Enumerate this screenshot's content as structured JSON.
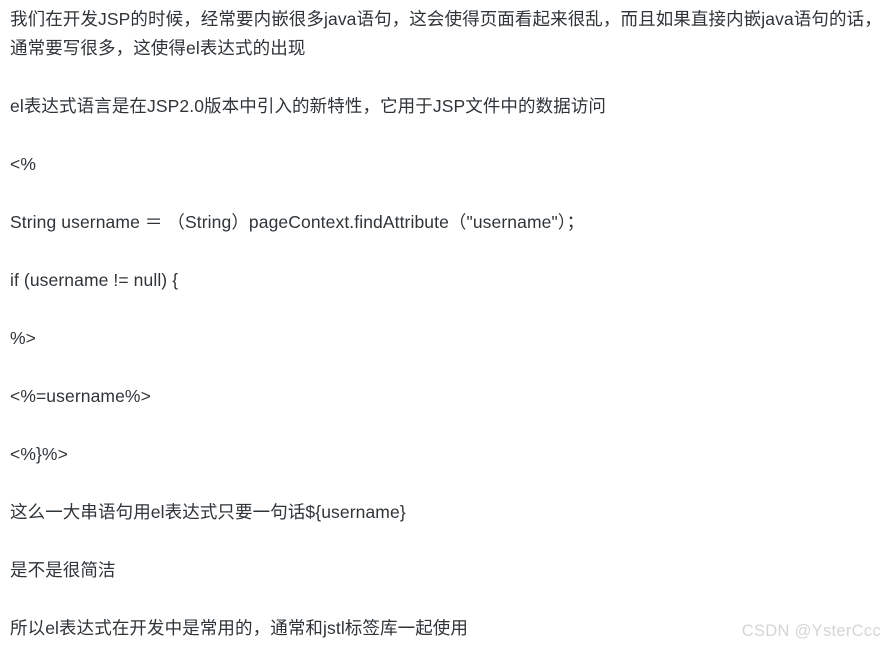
{
  "document": {
    "background_color": "#ffffff",
    "text_color": "#2f3438",
    "paragraphs": [
      {
        "id": "intro",
        "text": "我们在开发JSP的时候，经常要内嵌很多java语句，这会使得页面看起来很乱，而且如果直接内嵌java语句的话，通常要写很多，这使得el表达式的出现"
      },
      {
        "id": "definition",
        "text": "el表达式语言是在JSP2.0版本中引入的新特性，它用于JSP文件中的数据访问"
      },
      {
        "id": "code-open-scriptlet",
        "text": "<%"
      },
      {
        "id": "code-find-attribute",
        "text": "String username ＝ （String）pageContext.findAttribute（\"username\"）；"
      },
      {
        "id": "code-if-statement",
        "text": "if (username != null) {"
      },
      {
        "id": "code-close-scriptlet",
        "text": "%>"
      },
      {
        "id": "code-expression-output",
        "text": "<%=username%>"
      },
      {
        "id": "code-close-brace-scriptlet",
        "text": "<%}%>"
      },
      {
        "id": "el-one-liner",
        "text": "这么一大串语句用el表达式只要一句话${username}"
      },
      {
        "id": "question-concise",
        "text": "是不是很简洁"
      },
      {
        "id": "conclusion-jstl",
        "text": "所以el表达式在开发中是常用的，通常和jstl标签库一起使用"
      }
    ]
  },
  "watermark": {
    "text": "CSDN @YsterCcc",
    "color": "#d3d5d8"
  }
}
